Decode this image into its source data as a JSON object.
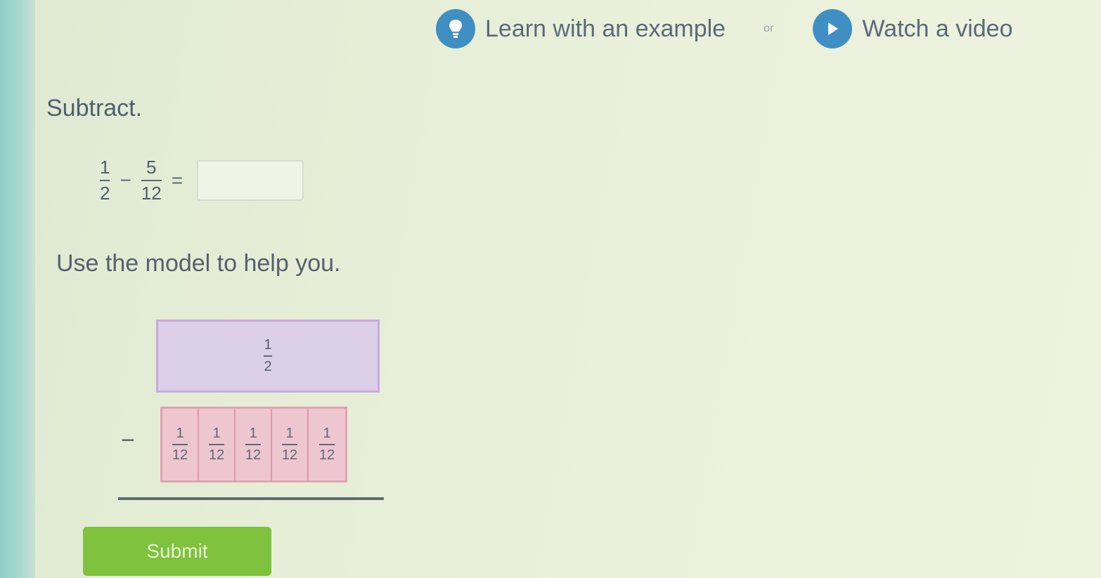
{
  "top_links": {
    "learn_label": "Learn with an example",
    "or_label": "or",
    "watch_label": "Watch a video",
    "learn_icon": "lightbulb-icon",
    "watch_icon": "play-icon"
  },
  "question": {
    "instruction": "Subtract.",
    "fraction_a": {
      "numerator": "1",
      "denominator": "2"
    },
    "operator": "−",
    "fraction_b": {
      "numerator": "5",
      "denominator": "12"
    },
    "equals": "=",
    "answer_value": "",
    "hint": "Use the model to help you."
  },
  "model": {
    "whole_label": {
      "numerator": "1",
      "denominator": "2"
    },
    "minus": "−",
    "pieces": [
      {
        "numerator": "1",
        "denominator": "12"
      },
      {
        "numerator": "1",
        "denominator": "12"
      },
      {
        "numerator": "1",
        "denominator": "12"
      },
      {
        "numerator": "1",
        "denominator": "12"
      },
      {
        "numerator": "1",
        "denominator": "12"
      }
    ]
  },
  "submit_label": "Submit",
  "colors": {
    "accent_blue": "#3f8fc3",
    "submit_green": "#7fc23d",
    "whole_purple": "#dccfe8",
    "piece_pink": "#eec6cf"
  }
}
